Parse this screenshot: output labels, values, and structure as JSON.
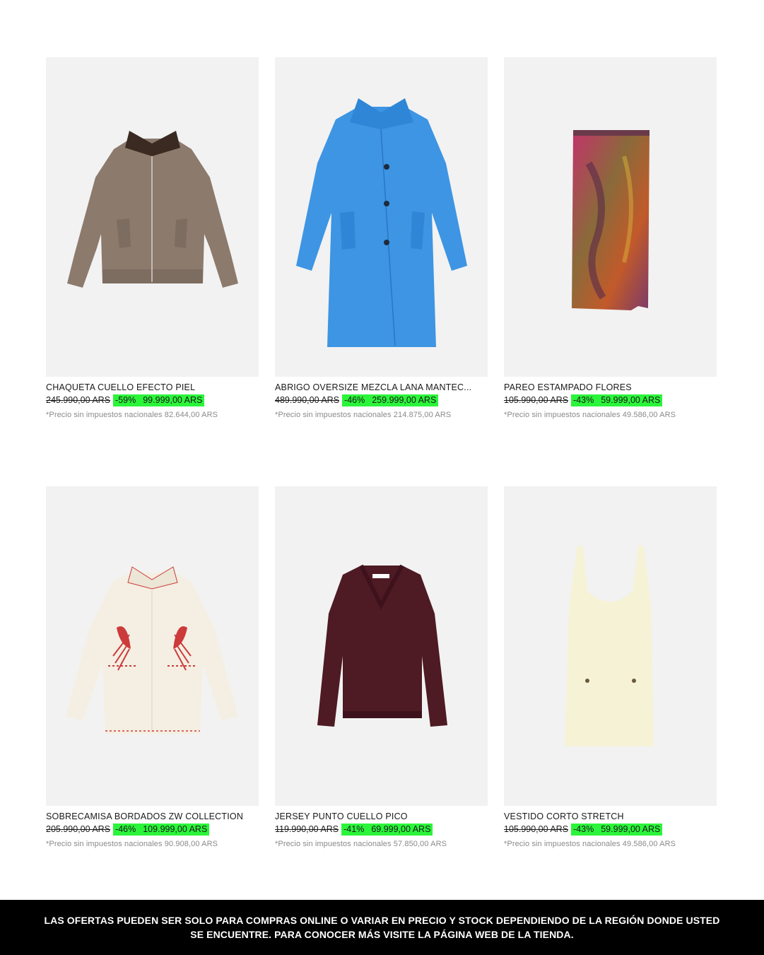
{
  "products": [
    {
      "name": "CHAQUETA CUELLO EFECTO PIEL",
      "old_price": "245.990,00 ARS",
      "discount": "-59%",
      "sale_price": "99.999,00 ARS",
      "tax_note": "*Precio sin impuestos nacionales 82.644,00 ARS",
      "image_icon": "jacket-icon"
    },
    {
      "name": "ABRIGO OVERSIZE MEZCLA LANA MANTEC...",
      "old_price": "489.990,00 ARS",
      "discount": "-46%",
      "sale_price": "259.999,00 ARS",
      "tax_note": "*Precio sin impuestos nacionales 214.875,00 ARS",
      "image_icon": "coat-icon"
    },
    {
      "name": "PAREO ESTAMPADO FLORES",
      "old_price": "105.990,00 ARS",
      "discount": "-43%",
      "sale_price": "59.999,00 ARS",
      "tax_note": "*Precio sin impuestos nacionales 49.586,00 ARS",
      "image_icon": "skirt-icon"
    },
    {
      "name": "SOBRECAMISA BORDADOS ZW COLLECTION",
      "old_price": "205.990,00 ARS",
      "discount": "-46%",
      "sale_price": "109.999,00 ARS",
      "tax_note": "*Precio sin impuestos nacionales 90.908,00 ARS",
      "image_icon": "overshirt-icon"
    },
    {
      "name": "JERSEY PUNTO CUELLO PICO",
      "old_price": "119.990,00 ARS",
      "discount": "-41%",
      "sale_price": "69.999,00 ARS",
      "tax_note": "*Precio sin impuestos nacionales 57.850,00 ARS",
      "image_icon": "sweater-icon"
    },
    {
      "name": "VESTIDO CORTO STRETCH",
      "old_price": "105.990,00 ARS",
      "discount": "-43%",
      "sale_price": "59.999,00 ARS",
      "tax_note": "*Precio sin impuestos nacionales 49.586,00 ARS",
      "image_icon": "dress-icon"
    }
  ],
  "footer": {
    "disclaimer": "LAS OFERTAS PUEDEN SER SOLO PARA COMPRAS ONLINE O VARIAR EN PRECIO Y STOCK DEPENDIENDO DE LA REGIÓN DONDE USTED SE ENCUENTRE. PARA CONOCER MÁS VISITE LA PÁGINA WEB DE LA TIENDA."
  },
  "colors": {
    "sale_highlight": "#2bf53a",
    "footer_bg": "#000000",
    "image_bg": "#f2f2f2"
  }
}
